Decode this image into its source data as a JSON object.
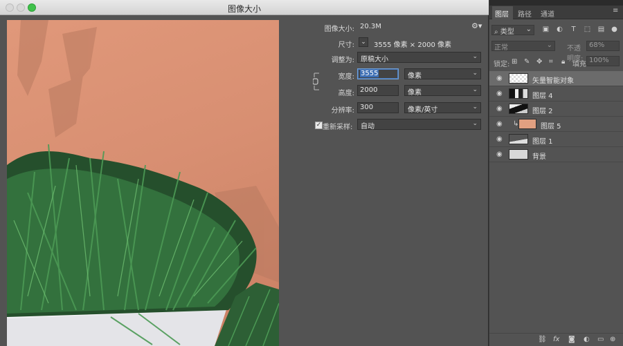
{
  "dialog": {
    "title": "图像大小",
    "image_size_label": "图像大小:",
    "image_size_value": "20.3M",
    "dimensions_label": "尺寸:",
    "dimensions_value": "3555 像素  ×  2000 像素",
    "fit_to_label": "调整为:",
    "fit_to_value": "原稿大小",
    "width_label": "宽度:",
    "width_value": "3555",
    "width_unit": "像素",
    "height_label": "高度:",
    "height_value": "2000",
    "height_unit": "像素",
    "resolution_label": "分辨率:",
    "resolution_value": "300",
    "resolution_unit": "像素/英寸",
    "resample_label": "重新采样:",
    "resample_checked": true,
    "resample_value": "自动"
  },
  "panel": {
    "tabs": [
      "图层",
      "路径",
      "通道"
    ],
    "filter_kind": "类型",
    "blend_mode": "正常",
    "opacity_label": "不透明度:",
    "opacity_value": "68%",
    "lock_label": "锁定:",
    "fill_label": "填充:",
    "fill_value": "100%",
    "layers": [
      {
        "name": "矢量智能对象",
        "selected": true,
        "visible": true
      },
      {
        "name": "图层 4",
        "selected": false,
        "visible": true
      },
      {
        "name": "图层 2",
        "selected": false,
        "visible": true
      },
      {
        "name": "图层 5",
        "selected": false,
        "visible": true,
        "clipped": true
      },
      {
        "name": "图层 1",
        "selected": false,
        "visible": true
      },
      {
        "name": "背景",
        "selected": false,
        "visible": true
      }
    ]
  },
  "colors": {
    "wall": "#d88f72",
    "grass": "#2f6a3a",
    "pot": "#e6e6ea",
    "selection": "#3d6fb4"
  }
}
